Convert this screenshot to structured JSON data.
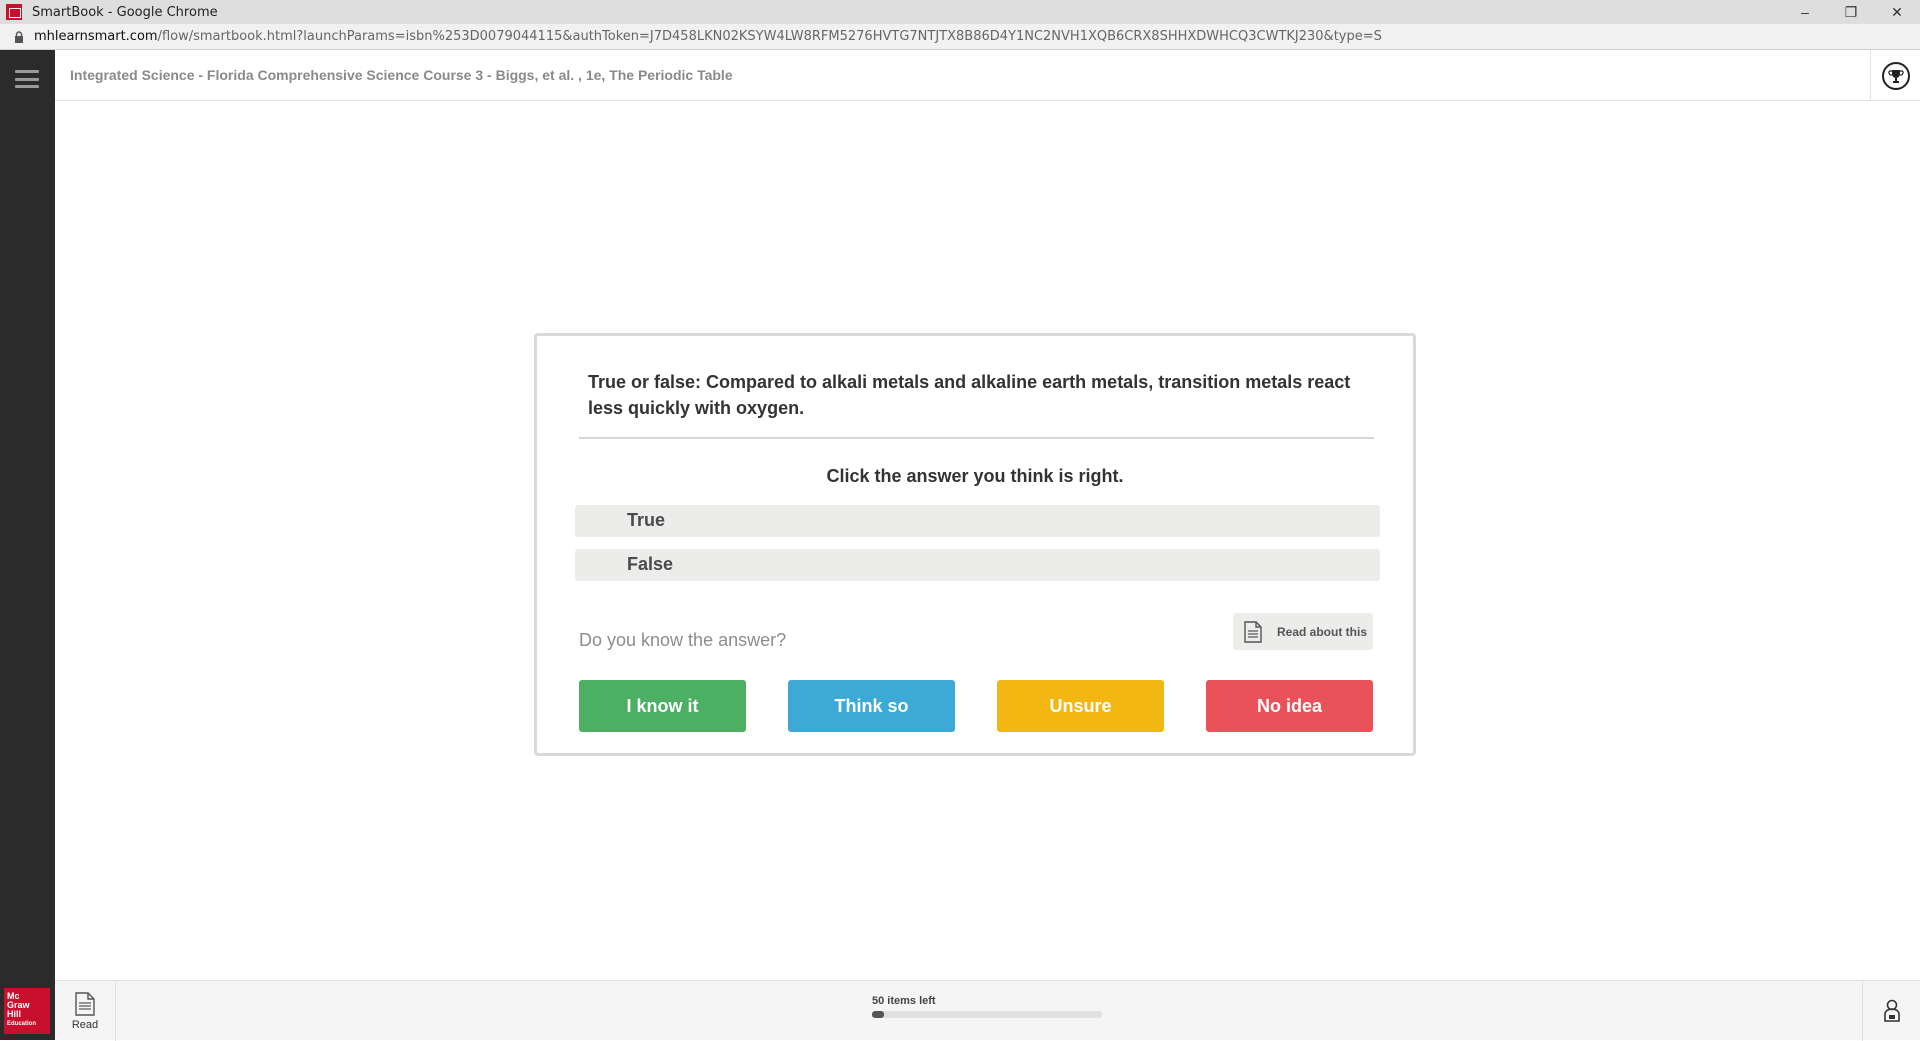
{
  "browser": {
    "window_title": "SmartBook - Google Chrome",
    "url_host": "mhlearnsmart.com",
    "url_path": "/flow/smartbook.html?launchParams=isbn%253D0079044115&authToken=J7D458LKN02KSYW4LW8RFM5276HVTG7NTJTX8B86D4Y1NC2NVH1XQB6CRX8SHHXDWHCQ3CWTKJ230&type=S",
    "controls": {
      "minimize": "–",
      "restore": "❐",
      "close": "✕"
    }
  },
  "header": {
    "course_title": "Integrated Science - Florida Comprehensive Science Course 3 - Biggs, et al. , 1e, The Periodic Table"
  },
  "question": {
    "prompt": "True or false: Compared to alkali metals and alkaline earth metals, transition metals react less quickly with oxygen.",
    "instruction": "Click the answer you think is right.",
    "options": [
      {
        "label": "True"
      },
      {
        "label": "False"
      }
    ],
    "confidence_prompt": "Do you know the answer?",
    "read_about_label": "Read about this",
    "confidence_buttons": [
      {
        "label": "I know it",
        "color": "#4caf63"
      },
      {
        "label": "Think so",
        "color": "#3ca9d6"
      },
      {
        "label": "Unsure",
        "color": "#f2b713"
      },
      {
        "label": "No idea",
        "color": "#e9525a"
      }
    ]
  },
  "footer": {
    "logo_lines": [
      "Mc",
      "Graw",
      "Hill",
      "Education"
    ],
    "read_label": "Read",
    "items_left": "50 items left",
    "progress_fraction": 0.05
  },
  "icons": {
    "menu": "hamburger-icon",
    "trophy": "trophy-icon",
    "doc": "document-icon",
    "user": "user-icon",
    "lock": "lock-icon"
  }
}
